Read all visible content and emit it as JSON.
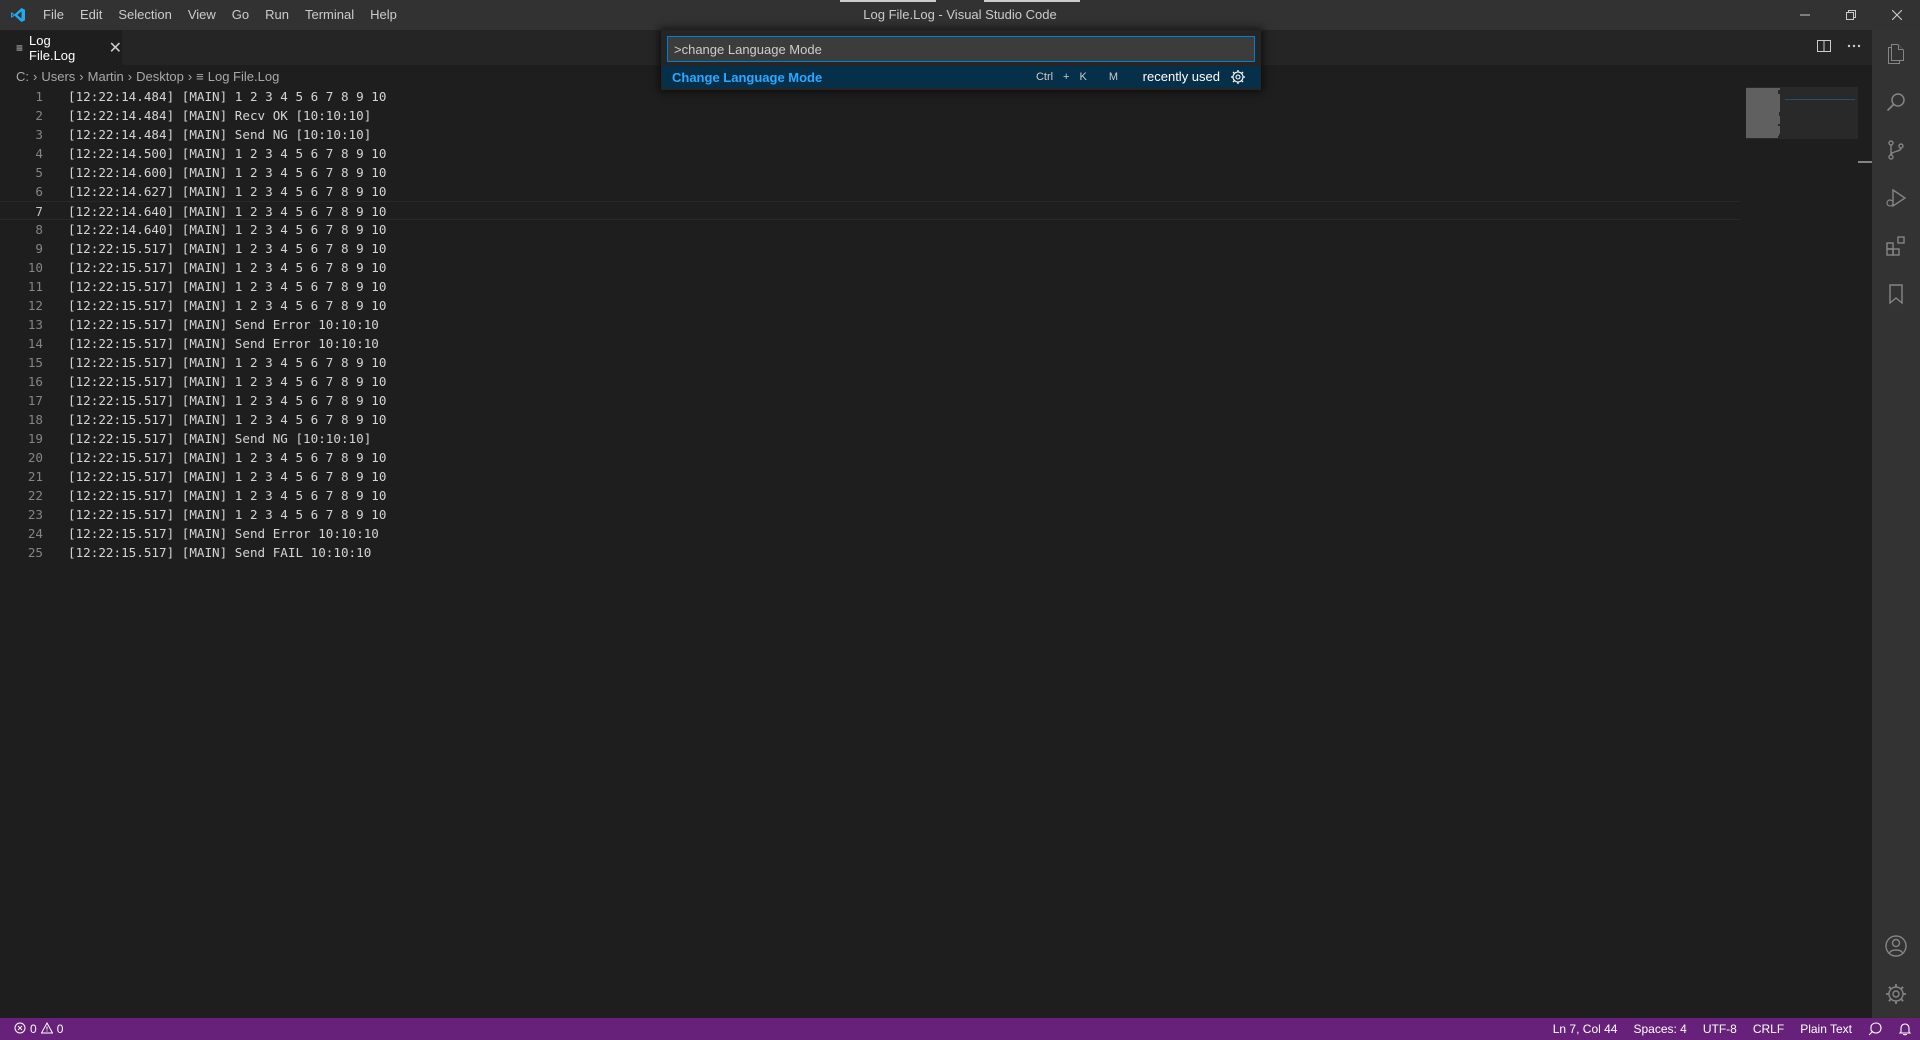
{
  "window": {
    "title": "Log File.Log - Visual Studio Code"
  },
  "menu": [
    "File",
    "Edit",
    "Selection",
    "View",
    "Go",
    "Run",
    "Terminal",
    "Help"
  ],
  "tab": {
    "label": "Log File.Log",
    "icon": "≡",
    "close": "✕"
  },
  "breadcrumb": {
    "parts": [
      "C:",
      "Users",
      "Martin",
      "Desktop"
    ],
    "file": "Log File.Log",
    "file_icon": "≡",
    "separator": "›"
  },
  "editor": {
    "current_line": 7,
    "lines": [
      "[12:22:14.484] [MAIN] 1 2 3 4 5 6 7 8 9 10",
      "[12:22:14.484] [MAIN] Recv OK [10:10:10]",
      "[12:22:14.484] [MAIN] Send NG [10:10:10]",
      "[12:22:14.500] [MAIN] 1 2 3 4 5 6 7 8 9 10",
      "[12:22:14.600] [MAIN] 1 2 3 4 5 6 7 8 9 10",
      "[12:22:14.627] [MAIN] 1 2 3 4 5 6 7 8 9 10",
      "[12:22:14.640] [MAIN] 1 2 3 4 5 6 7 8 9 10",
      "[12:22:14.640] [MAIN] 1 2 3 4 5 6 7 8 9 10",
      "[12:22:15.517] [MAIN] 1 2 3 4 5 6 7 8 9 10",
      "[12:22:15.517] [MAIN] 1 2 3 4 5 6 7 8 9 10",
      "[12:22:15.517] [MAIN] 1 2 3 4 5 6 7 8 9 10",
      "[12:22:15.517] [MAIN] 1 2 3 4 5 6 7 8 9 10",
      "[12:22:15.517] [MAIN] Send Error 10:10:10",
      "[12:22:15.517] [MAIN] Send Error 10:10:10",
      "[12:22:15.517] [MAIN] 1 2 3 4 5 6 7 8 9 10",
      "[12:22:15.517] [MAIN] 1 2 3 4 5 6 7 8 9 10",
      "[12:22:15.517] [MAIN] 1 2 3 4 5 6 7 8 9 10",
      "[12:22:15.517] [MAIN] 1 2 3 4 5 6 7 8 9 10",
      "[12:22:15.517] [MAIN] Send NG [10:10:10]",
      "[12:22:15.517] [MAIN] 1 2 3 4 5 6 7 8 9 10",
      "[12:22:15.517] [MAIN] 1 2 3 4 5 6 7 8 9 10",
      "[12:22:15.517] [MAIN] 1 2 3 4 5 6 7 8 9 10",
      "[12:22:15.517] [MAIN] 1 2 3 4 5 6 7 8 9 10",
      "[12:22:15.517] [MAIN] Send Error 10:10:10",
      "[12:22:15.517] [MAIN] Send FAIL 10:10:10"
    ]
  },
  "command_palette": {
    "input_value": ">change Language Mode",
    "result_label": "Change Language Mode",
    "keybinding": [
      "Ctrl",
      "+",
      "K",
      "M"
    ],
    "hint": "recently used"
  },
  "activity_bar": [
    "explorer-icon",
    "search-icon",
    "source-control-icon",
    "run-debug-icon",
    "extensions-icon",
    "bookmarks-icon",
    "accounts-icon",
    "manage-gear-icon"
  ],
  "status_bar": {
    "errors": "0",
    "warnings": "0",
    "position": "Ln 7, Col 44",
    "indent": "Spaces: 4",
    "encoding": "UTF-8",
    "eol": "CRLF",
    "language": "Plain Text"
  },
  "colors": {
    "status_bar": "#68217a",
    "palette_highlight": "#2aaaff",
    "editor_bg": "#1e1e1e"
  }
}
